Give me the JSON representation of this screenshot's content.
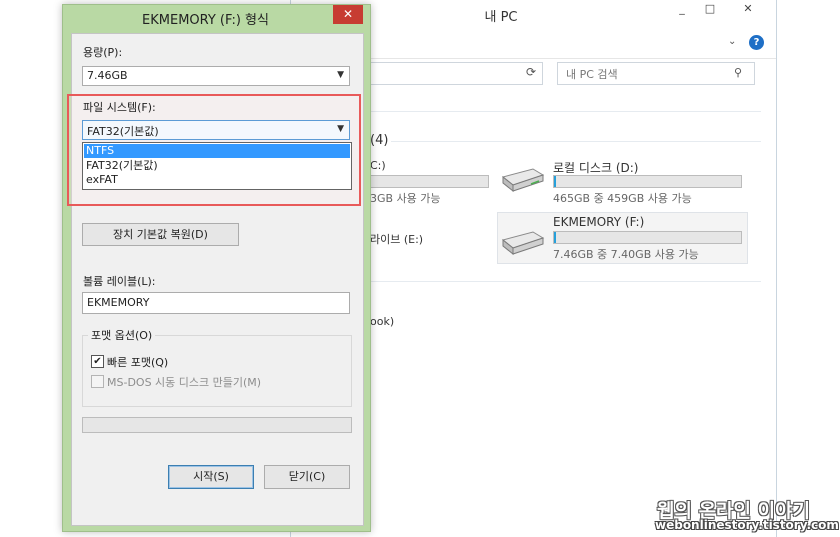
{
  "explorer": {
    "title": "내 PC",
    "window_controls": [
      "_",
      "□",
      "✕"
    ],
    "help_label": "?",
    "search_placeholder": "내 PC 검색",
    "section_partial": "(4)",
    "drive_c_name_partial": "C:)",
    "drive_c_sub_partial": "3GB 사용 가능",
    "drive_d": {
      "name": "로컬 디스크 (D:)",
      "sub": "465GB 중 459GB 사용 가능",
      "used_fraction": 0.013
    },
    "drive_f": {
      "name": "EKMEMORY (F:)",
      "sub": "7.46GB 중 7.40GB 사용 가능",
      "used_fraction": 0.008
    },
    "drive_e_partial": "라이브 (E:)",
    "other_partial": "ook)"
  },
  "dialog": {
    "title": "EKMEMORY (F:) 형식",
    "close_label": "✕",
    "capacity_label": "용량(P):",
    "capacity_value": "7.46GB",
    "filesystem_label": "파일 시스템(F):",
    "filesystem_value": "FAT32(기본값)",
    "filesystem_options": [
      "NTFS",
      "FAT32(기본값)",
      "exFAT"
    ],
    "filesystem_selected": "NTFS",
    "restore_button": "장치 기본값 복원(D)",
    "volume_label": "볼륨 레이블(L):",
    "volume_value": "EKMEMORY",
    "format_options_title": "포맷 옵션(O)",
    "quick_format_label": "빠른 포맷(Q)",
    "quick_format_checked": true,
    "msdos_label": "MS-DOS 시동 디스크 만들기(M)",
    "msdos_checked": false,
    "start_button": "시작(S)",
    "close_button": "닫기(C)"
  },
  "watermark": {
    "line1": "웹의 온라인 이야기",
    "line2": "webonlinestory.tistory.com"
  },
  "colors": {
    "dialog_frame": "#b9d9a4",
    "close_red": "#c73c32",
    "selection_blue": "#3399ff",
    "highlight_box": "#e85a5a",
    "drive_bar": "#26a0da"
  }
}
